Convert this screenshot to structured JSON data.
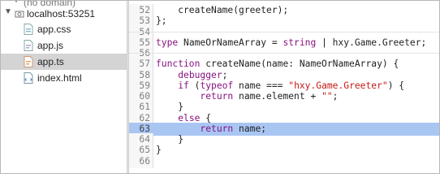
{
  "tree": {
    "domain_label": "(no domain)",
    "host_label": "localhost:53251",
    "files": [
      {
        "name": "app.css",
        "icon": "css-file-icon",
        "selected": false
      },
      {
        "name": "app.js",
        "icon": "js-file-icon",
        "selected": false
      },
      {
        "name": "app.ts",
        "icon": "ts-file-icon",
        "selected": true
      },
      {
        "name": "index.html",
        "icon": "html-file-icon",
        "selected": false
      }
    ]
  },
  "editor": {
    "highlight_color": "#a9c6f3",
    "lines": [
      {
        "n": "52",
        "text": "    createName(greeter);"
      },
      {
        "n": "53",
        "text": "};"
      },
      {
        "n": "54",
        "text": ""
      },
      {
        "n": "55",
        "text": "type NameOrNameArray = string | hxy.Game.Greeter;"
      },
      {
        "n": "56",
        "text": ""
      },
      {
        "n": "57",
        "text": "function createName(name: NameOrNameArray) {"
      },
      {
        "n": "58",
        "text": "    debugger;"
      },
      {
        "n": "59",
        "text": "    if (typeof name === \"hxy.Game.Greeter\") {"
      },
      {
        "n": "60",
        "text": "        return name.element + \"\";"
      },
      {
        "n": "61",
        "text": "    }"
      },
      {
        "n": "62",
        "text": "    else {"
      },
      {
        "n": "63",
        "text": "        return name;"
      },
      {
        "n": "64",
        "text": "    }"
      },
      {
        "n": "65",
        "text": "}"
      },
      {
        "n": "66",
        "text": ""
      }
    ]
  }
}
